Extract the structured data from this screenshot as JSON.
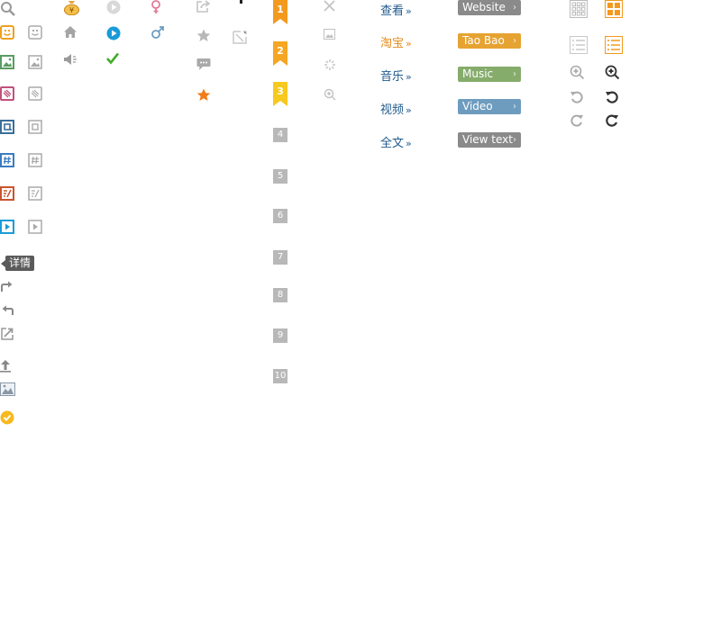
{
  "ribbons": [
    {
      "label": "1",
      "color": "#f39a1e"
    },
    {
      "label": "2",
      "color": "#f5a623"
    },
    {
      "label": "3",
      "color": "#f7c81e"
    }
  ],
  "numbers": [
    "4",
    "5",
    "6",
    "7",
    "8",
    "9",
    "10"
  ],
  "links": [
    {
      "label": "查看",
      "color": "#1f5a8c"
    },
    {
      "label": "淘宝",
      "color": "#e38b1a"
    },
    {
      "label": "音乐",
      "color": "#1f5a8c"
    },
    {
      "label": "视频",
      "color": "#1f5a8c"
    },
    {
      "label": "全文",
      "color": "#1f5a8c"
    }
  ],
  "link_chevron": "»",
  "pills": [
    {
      "label": "Website",
      "color": "#8a8a8a"
    },
    {
      "label": "Tao Bao",
      "color": "#e6a332"
    },
    {
      "label": "Music",
      "color": "#86ac6c"
    },
    {
      "label": "Video",
      "color": "#6d9cbf"
    },
    {
      "label": "View text",
      "color": "#8a8a8a"
    }
  ],
  "pill_arrow": "›",
  "tooltip": {
    "label": "详情"
  },
  "colors": {
    "orange": "#f39a1e",
    "gray": "#a9a9a9",
    "blue": "#1a9bd8",
    "green": "#3fae29",
    "dark": "#333333"
  }
}
